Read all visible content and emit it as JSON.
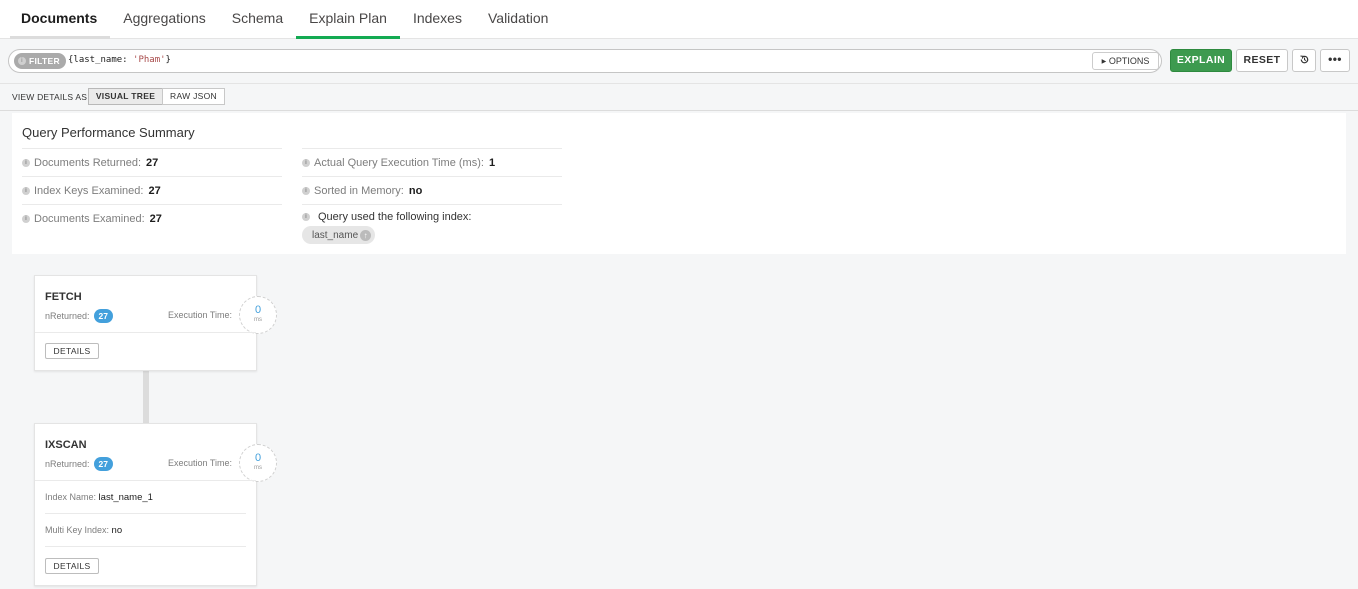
{
  "tabs": [
    {
      "label": "Documents"
    },
    {
      "label": "Aggregations"
    },
    {
      "label": "Schema"
    },
    {
      "label": "Explain Plan"
    },
    {
      "label": "Indexes"
    },
    {
      "label": "Validation"
    }
  ],
  "filter": {
    "pill_label": "FILTER",
    "query_prefix": "{last_name: ",
    "query_string": "'Pham'",
    "query_suffix": "}",
    "options_label": "OPTIONS",
    "explain_label": "EXPLAIN",
    "reset_label": "RESET"
  },
  "view": {
    "label": "VIEW DETAILS AS",
    "visual_tree": "VISUAL TREE",
    "raw_json": "RAW JSON"
  },
  "summary": {
    "title": "Query Performance Summary",
    "docs_returned_label": "Documents Returned:",
    "docs_returned": "27",
    "keys_examined_label": "Index Keys Examined:",
    "keys_examined": "27",
    "docs_examined_label": "Documents Examined:",
    "docs_examined": "27",
    "exec_time_label": "Actual Query Execution Time (ms):",
    "exec_time": "1",
    "sorted_label": "Sorted in Memory:",
    "sorted": "no",
    "index_used_label": "Query used the following index:",
    "index_name": "last_name"
  },
  "stages": {
    "fetch": {
      "name": "FETCH",
      "nreturned_label": "nReturned:",
      "nreturned": "27",
      "exec_label": "Execution Time:",
      "exec_value": "0",
      "exec_unit": "ms",
      "details_label": "DETAILS"
    },
    "ixscan": {
      "name": "IXSCAN",
      "nreturned_label": "nReturned:",
      "nreturned": "27",
      "exec_label": "Execution Time:",
      "exec_value": "0",
      "exec_unit": "ms",
      "index_name_label": "Index Name:",
      "index_name": "last_name_1",
      "multikey_label": "Multi Key Index:",
      "multikey": "no",
      "details_label": "DETAILS"
    }
  },
  "colors": {
    "active_tab_underline": "#13aa52",
    "explain_button": "#3d9a4f",
    "badge_blue": "#43a0dc"
  },
  "icons": {
    "info": "info-icon",
    "chevron": "chevron-right-icon",
    "history": "history-icon",
    "more": "ellipsis-icon",
    "index_direction": "arrow-up-icon"
  }
}
